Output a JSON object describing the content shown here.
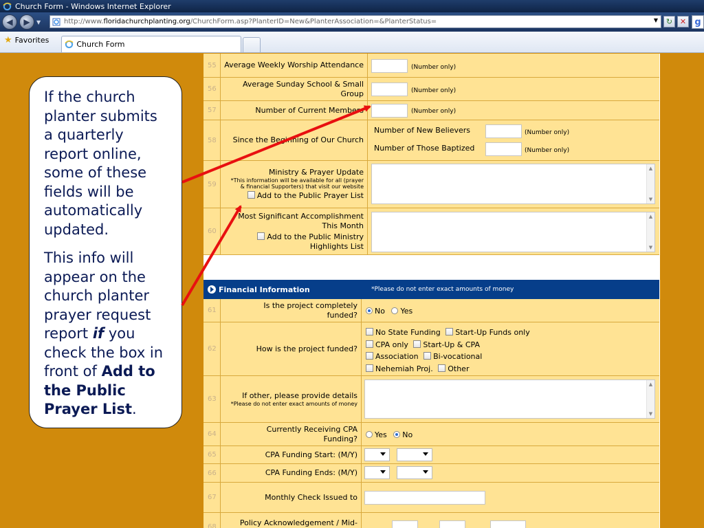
{
  "window": {
    "title": "Church Form - Windows Internet Explorer"
  },
  "address": {
    "prefix": "http://www.",
    "domain": "floridachurchplanting.org",
    "path": "/ChurchForm.asp?PlanterID=New&PlanterAssociation=&PlanterStatus="
  },
  "favorites": {
    "label": "Favorites"
  },
  "tab": {
    "label": "Church Form"
  },
  "rows": {
    "r55": {
      "num": "55",
      "label": "Average Weekly Worship Attendance",
      "hint": "(Number only)"
    },
    "r56": {
      "num": "56",
      "label": "Average Sunday School & Small Group",
      "hint": "(Number only)"
    },
    "r57": {
      "num": "57",
      "label": "Number of Current Members",
      "hint": "(Number only)"
    },
    "r58": {
      "num": "58",
      "label": "Since the Beginning of Our Church",
      "sub1": "Number of New Believers",
      "sub2": "Number of Those Baptized",
      "hint": "(Number only)"
    },
    "r59": {
      "num": "59",
      "label": "Ministry & Prayer Update",
      "small": "*This information will be available for all (prayer & financial Supporters) that visit our website",
      "check": "Add to the Public Prayer List"
    },
    "r60": {
      "num": "60",
      "label": "Most Significant Accomplishment This Month",
      "check": "Add to the Public Ministry Highlights List"
    }
  },
  "financial": {
    "title": "Financial Information",
    "note": "*Please do not enter exact amounts of money"
  },
  "frows": {
    "r61": {
      "num": "61",
      "label": "Is the project completely funded?",
      "opt_no": "No",
      "opt_yes": "Yes"
    },
    "r62": {
      "num": "62",
      "label": "How is the project funded?",
      "options": [
        "No State Funding",
        "Start-Up Funds only",
        "CPA only",
        "Start-Up & CPA",
        "Association",
        "Bi-vocational",
        "Nehemiah Proj.",
        "Other"
      ]
    },
    "r63": {
      "num": "63",
      "label": "If other, please provide details",
      "small": "*Please do not enter exact amounts of money"
    },
    "r64": {
      "num": "64",
      "label": "Currently Receiving CPA Funding?",
      "opt_yes": "Yes",
      "opt_no": "No"
    },
    "r65": {
      "num": "65",
      "label": "CPA Funding Start: (M/Y)"
    },
    "r66": {
      "num": "66",
      "label": "CPA Funding Ends: (M/Y)"
    },
    "r67": {
      "num": "67",
      "label": "Monthly Check Issued to"
    },
    "r68": {
      "num": "68",
      "label": "Policy Acknowledgement / Mid-"
    }
  },
  "callout": {
    "p1": "If the church planter submits a quarterly report online, some of these fields will be automatically updated.",
    "p2_a": "This info will appear on the church planter prayer request report ",
    "p2_if": "if",
    "p2_b": " you check the box in front of ",
    "p2_bold": "Add to the Public Prayer List",
    "p2_end": "."
  },
  "colors": {
    "page_bg": "#d08a0c",
    "row_bg": "#ffe394",
    "header_bg": "#063e8a",
    "arrow": "#e81010",
    "callout_text": "#0b1a55"
  }
}
